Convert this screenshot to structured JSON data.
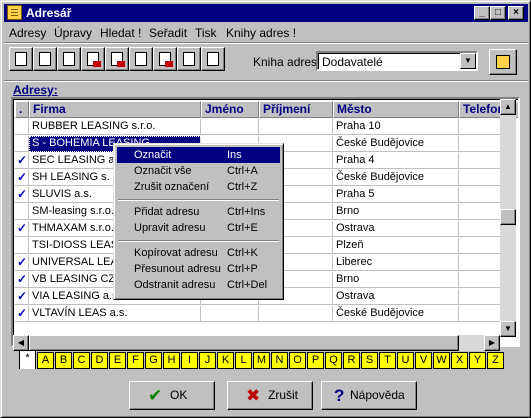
{
  "window": {
    "title": "Adresář"
  },
  "title_buttons": [
    "_",
    "□",
    "×"
  ],
  "menu": [
    "Adresy",
    "Úpravy",
    "Hledat !",
    "Seřadit",
    "Tisk",
    "Knihy adres !"
  ],
  "toolbar": {
    "buttons": [
      "new-icon",
      "edit-icon",
      "delete-icon",
      "import-icon",
      "export-icon",
      "print-icon",
      "print-preview-icon",
      "sort-icon",
      "select-icon"
    ]
  },
  "book": {
    "label": "Kniha adres:",
    "value": "Dodavatelé"
  },
  "grid": {
    "caption": "Adresy:",
    "columns": [
      "Firma",
      "Jméno",
      "Příjmení",
      "Město",
      "Telefon"
    ],
    "rows": [
      {
        "checked": false,
        "firma": "RUBBER LEASING s.r.o.",
        "mesto": "Praha 10"
      },
      {
        "checked": false,
        "firma": "S - BOHEMIA LEASING",
        "mesto": "České Budějovice"
      },
      {
        "checked": true,
        "firma": "SEC LEASING a.",
        "mesto": "Praha 4"
      },
      {
        "checked": true,
        "firma": "SH LEASING s. r.",
        "mesto": "České Budějovice"
      },
      {
        "checked": true,
        "firma": "SLUVIS a.s.",
        "mesto": "Praha 5"
      },
      {
        "checked": false,
        "firma": "SM-leasing s.r.o.",
        "mesto": "Brno"
      },
      {
        "checked": true,
        "firma": "THMAXAM s.r.o.",
        "mesto": "Ostrava"
      },
      {
        "checked": false,
        "firma": "TSI-DIOSS LEAS",
        "mesto": "Plzeň"
      },
      {
        "checked": true,
        "firma": "UNIVERSAL LEA",
        "mesto": "Liberec"
      },
      {
        "checked": true,
        "firma": "VB LEASING CZ",
        "mesto": "Brno"
      },
      {
        "checked": true,
        "firma": "VIA LEASING a.s.",
        "mesto": "Ostrava"
      },
      {
        "checked": true,
        "firma": "VLTAVÍN LEAS a.s.",
        "mesto": "České Budějovice"
      }
    ]
  },
  "context_menu": {
    "items": [
      {
        "label": "Označit",
        "shortcut": "Ins"
      },
      {
        "label": "Označit vše",
        "shortcut": "Ctrl+A"
      },
      {
        "label": "Zrušit označení",
        "shortcut": "Ctrl+Z"
      },
      {
        "label": "Přidat adresu",
        "shortcut": "Ctrl+Ins"
      },
      {
        "label": "Upravit adresu",
        "shortcut": "Ctrl+E"
      },
      {
        "label": "Kopírovat adresu",
        "shortcut": "Ctrl+K"
      },
      {
        "label": "Přesunout adresu",
        "shortcut": "Ctrl+P"
      },
      {
        "label": "Odstranit adresu",
        "shortcut": "Ctrl+Del"
      }
    ]
  },
  "tabs": [
    "*",
    "A",
    "B",
    "C",
    "D",
    "E",
    "F",
    "G",
    "H",
    "I",
    "J",
    "K",
    "L",
    "M",
    "N",
    "O",
    "P",
    "Q",
    "R",
    "S",
    "T",
    "U",
    "V",
    "W",
    "X",
    "Y",
    "Z"
  ],
  "buttons": {
    "ok": "OK",
    "cancel": "Zrušit",
    "help": "Nápověda"
  }
}
